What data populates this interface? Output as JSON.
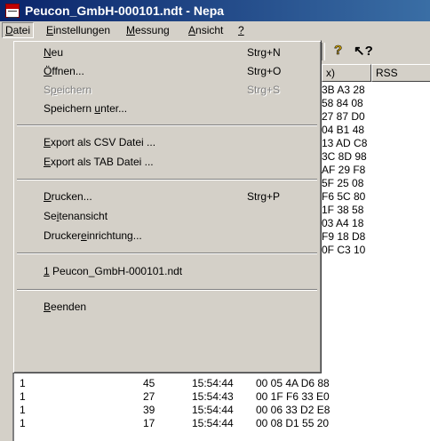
{
  "window": {
    "title": "Peucon_GmbH-000101.ndt - Nepa"
  },
  "menubar": {
    "datei": {
      "underline": "D",
      "rest": "atei"
    },
    "einstellungen": {
      "underline": "E",
      "rest": "instellungen"
    },
    "messung": {
      "underline": "M",
      "rest": "essung"
    },
    "ansicht": {
      "underline": "A",
      "rest": "nsicht"
    },
    "hilfe": {
      "underline": "?",
      "rest": ""
    }
  },
  "toolbar": {
    "help_label": "?",
    "context_help_label": "↖?"
  },
  "table": {
    "headers": [
      "x)",
      "RSS"
    ],
    "side_values": [
      "3B A3 28",
      "58 84 08",
      "27 87 D0",
      "04 B1 48",
      "13 AD C8",
      "3C 8D 98",
      "AF 29 F8",
      "5F 25 08",
      "F6 5C 80",
      "1F 38 58",
      "03 A4 18",
      "F9 18 D8",
      "0F C3 10"
    ],
    "rows": [
      {
        "col1": "1",
        "col2": "45",
        "col3": "15:54:44",
        "col4": "00 05 4A D6 88"
      },
      {
        "col1": "1",
        "col2": "27",
        "col3": "15:54:43",
        "col4": "00 1F F6 33 E0"
      },
      {
        "col1": "1",
        "col2": "39",
        "col3": "15:54:44",
        "col4": "00 06 33 D2 E8"
      },
      {
        "col1": "1",
        "col2": "17",
        "col3": "15:54:44",
        "col4": "00 08 D1 55 20"
      }
    ]
  },
  "datei_menu": {
    "neu": {
      "pre": "",
      "u": "N",
      "post": "eu",
      "shortcut": "Strg+N"
    },
    "oeffnen": {
      "pre": "",
      "u": "Ö",
      "post": "ffnen...",
      "shortcut": "Strg+O"
    },
    "speichern": {
      "pre": "S",
      "u": "p",
      "post": "eichern",
      "shortcut": "Strg+S"
    },
    "speichern_unter": {
      "pre": "Speichern ",
      "u": "u",
      "post": "nter...",
      "shortcut": ""
    },
    "export_csv": {
      "pre": "",
      "u": "E",
      "post": "xport als CSV Datei ...",
      "shortcut": ""
    },
    "export_tab": {
      "pre": "",
      "u": "E",
      "post": "xport als TAB Datei ...",
      "shortcut": ""
    },
    "drucken": {
      "pre": "",
      "u": "D",
      "post": "rucken...",
      "shortcut": "Strg+P"
    },
    "seitenansicht": {
      "pre": "Se",
      "u": "i",
      "post": "tenansicht",
      "shortcut": ""
    },
    "druckereinrichtung": {
      "pre": "Drucker",
      "u": "e",
      "post": "inrichtung...",
      "shortcut": ""
    },
    "recent1": {
      "pre": "",
      "u": "1",
      "post": " Peucon_GmbH-000101.ndt",
      "shortcut": ""
    },
    "beenden": {
      "pre": "",
      "u": "B",
      "post": "eenden",
      "shortcut": ""
    }
  }
}
